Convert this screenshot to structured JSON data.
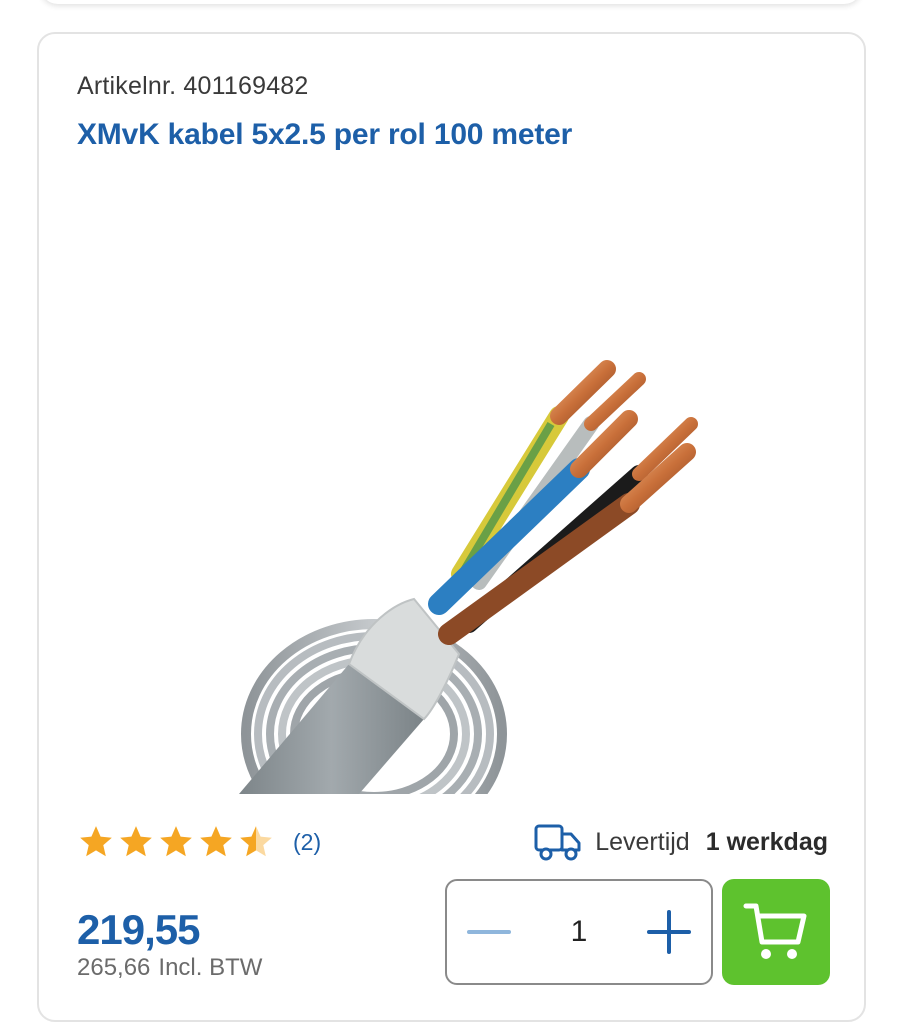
{
  "product": {
    "article_label": "Artikelnr.",
    "article_number": "401169482",
    "title": "XMvK kabel 5x2.5 per rol 100 meter"
  },
  "rating": {
    "stars": 4.5,
    "max_stars": 5,
    "review_count": "(2)",
    "star_color": "#f5a623"
  },
  "delivery": {
    "label": "Levertijd",
    "value": "1 werkdag"
  },
  "price": {
    "amount": "219,55",
    "incl_amount": "265,66",
    "incl_label": "Incl. BTW"
  },
  "quantity": {
    "value": "1",
    "minus_icon": "minus-icon",
    "plus_icon": "plus-icon"
  },
  "cart": {
    "icon": "shopping-cart-icon",
    "color": "#5ec22e"
  },
  "colors": {
    "brand_blue": "#1d5fa8",
    "text_gray": "#6b6b6b"
  }
}
